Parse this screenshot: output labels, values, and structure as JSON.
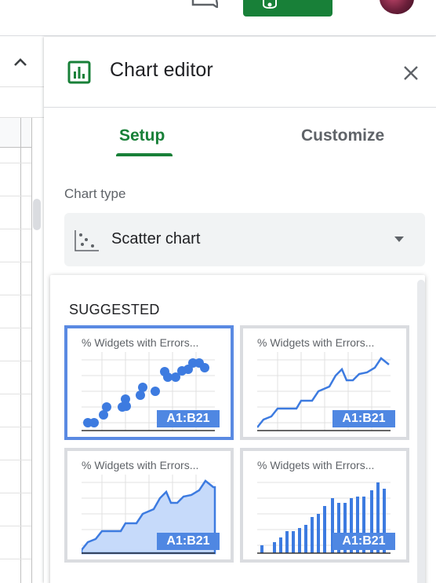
{
  "panel": {
    "title": "Chart editor",
    "tabs": [
      {
        "label": "Setup",
        "active": true
      },
      {
        "label": "Customize",
        "active": false
      }
    ],
    "chart_type_label": "Chart type",
    "chart_type_value": "Scatter chart",
    "suggested_label": "SUGGESTED",
    "suggestions": [
      {
        "title": "% Widgets with Errors...",
        "kind": "scatter",
        "range": "A1:B21",
        "selected": true
      },
      {
        "title": "% Widgets with Errors...",
        "kind": "line",
        "range": "A1:B21",
        "selected": false
      },
      {
        "title": "% Widgets with Errors...",
        "kind": "area",
        "range": "A1:B21",
        "selected": false
      },
      {
        "title": "% Widgets with Errors...",
        "kind": "column",
        "range": "A1:B21",
        "selected": false
      }
    ]
  },
  "colors": {
    "accent_green": "#188038",
    "series_blue": "#4f87e2",
    "selected_border": "#5a8ae2"
  },
  "icons": [
    "comment-icon",
    "share-icon",
    "collapse-chevron-icon",
    "bar-chart-icon",
    "close-icon",
    "scatter-chart-icon",
    "dropdown-arrow-icon"
  ]
}
